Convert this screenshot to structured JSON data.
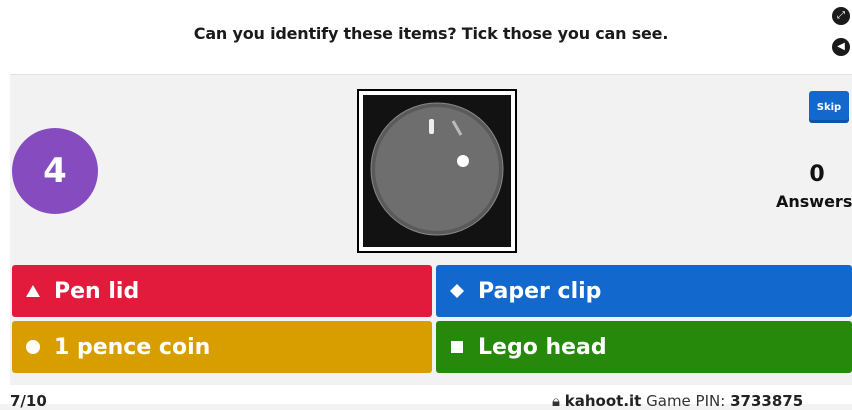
{
  "header": {
    "question": "Can you identify these items? Tick those you can see."
  },
  "controls": {
    "fullscreen_icon": "fullscreen-icon",
    "back_icon": "back-icon"
  },
  "timer": {
    "value": "4",
    "color": "#864cbf"
  },
  "skip_label": "Skip",
  "answers_count": "0",
  "answers_label": "Answers",
  "answers": [
    {
      "label": "Pen lid",
      "symbol": "triangle",
      "color": "#e21b3c"
    },
    {
      "label": "Paper clip",
      "symbol": "diamond",
      "color": "#1368ce"
    },
    {
      "label": "1 pence coin",
      "symbol": "circle",
      "color": "#d89e00"
    },
    {
      "label": "Lego head",
      "symbol": "square",
      "color": "#26890c"
    }
  ],
  "footer": {
    "progress": "7/10",
    "site": "kahoot.it",
    "pin_label": "Game PIN:",
    "pin": "3733875"
  }
}
